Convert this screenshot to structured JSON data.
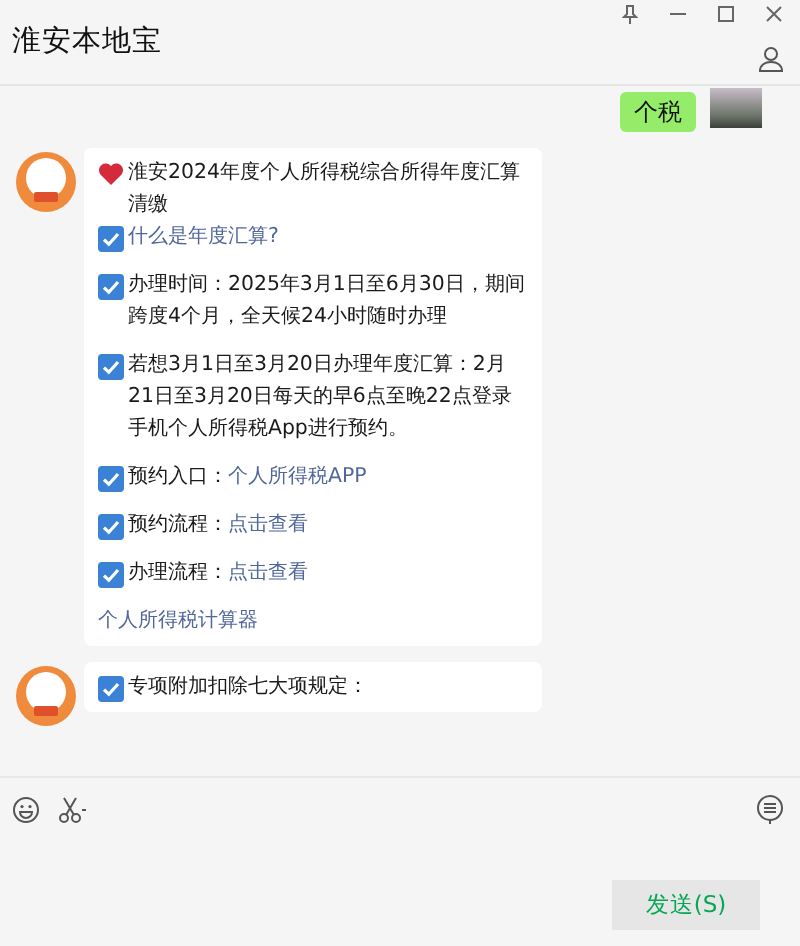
{
  "window": {
    "title": "淮安本地宝"
  },
  "messages": [
    {
      "kind": "sent",
      "text": "个税"
    },
    {
      "kind": "received",
      "blocks": [
        [
          {
            "kind": "heart",
            "text": "淮安2024年度个人所得税综合所得年度汇算清缴"
          },
          {
            "kind": "check",
            "link": "什么是年度汇算?"
          }
        ],
        [
          {
            "kind": "check",
            "text": "办理时间：2025年3月1日至6月30日，期间跨度4个月，全天候24小时随时办理"
          }
        ],
        [
          {
            "kind": "check",
            "text": "若想3月1日至3月20日办理年度汇算：2月21日至3月20日每天的早6点至晚22点登录手机个人所得税App进行预约。"
          }
        ],
        [
          {
            "kind": "check",
            "text": "预约入口：",
            "link": "个人所得税APP"
          }
        ],
        [
          {
            "kind": "check",
            "text": "预约流程：",
            "link": "点击查看"
          }
        ],
        [
          {
            "kind": "check",
            "text": "办理流程：",
            "link": "点击查看"
          }
        ],
        [
          {
            "kind": "plain",
            "link": "个人所得税计算器"
          }
        ]
      ]
    },
    {
      "kind": "received",
      "blocks": [
        [
          {
            "kind": "check",
            "text": "专项附加扣除七大项规定："
          }
        ]
      ]
    }
  ],
  "send_button": "发送(S)"
}
